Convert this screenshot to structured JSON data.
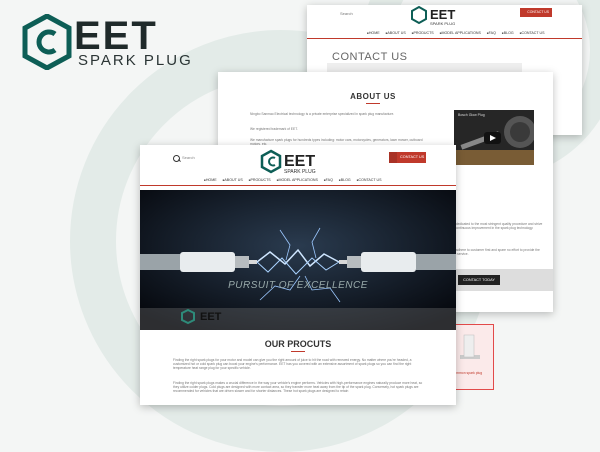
{
  "brand": {
    "name": "EET",
    "sub": "SPARK PLUG"
  },
  "colors": {
    "accent": "#c0392b",
    "brand_green": "#0d5e56"
  },
  "window_back": {
    "search_placeholder": "Search",
    "contact_label": "CONTACT US",
    "nav": [
      "HOME",
      "ABOUT US",
      "PRODUCTS",
      "MODEL APPLICATIONS",
      "FAQ",
      "BLOG",
      "CONTACT US"
    ],
    "page_title": "CONTACT US"
  },
  "window_mid": {
    "section_title": "ABOUT US",
    "paragraphs": [
      "Ningbo Sanmao Electrical technology is a private enterprise specialized in spark plug manufacture.",
      "We registered trademark of EET.",
      "We manufacture spark plugs for hundreds types including: motor cars, motorcycles, generators, lawn mower, outboard motors, etc.",
      "We dedicated to the most stringent quality procedure and strive for continuous improvement in the spark plug technology.",
      "We adhere to customer first and spare no effort to provide the best service."
    ],
    "video_title": "Bosch Glow Plug",
    "contact_today": "CONTACT TODAY",
    "product_caption": "Common spark plug"
  },
  "window_front": {
    "search_placeholder": "Search",
    "contact_label": "CONTACT US",
    "nav": [
      "HOME",
      "ABOUT US",
      "PRODUCTS",
      "MODEL APPLICATIONS",
      "FAQ",
      "BLOG",
      "CONTACT US"
    ],
    "hero_tagline": "PURSUIT OF EXCELLENCE",
    "hero_logo": "EET",
    "section_title": "OUR PROCUTS",
    "paragraphs": [
      "Finding the right spark plugs for your motor and model can give you the right amount of juice to hit the road with renewed energy. No matter where you're headed, a customized hot or cold spark plug can boost your engine's performance. EET has you covered with an extensive assortment of spark plugs so you can find the right temperature heat range plug for your specific vehicle.",
      "Finding the right spark plugs makes a crucial difference in the way your vehicle's engine performs. Vehicles with high-performance engines naturally produce more heat, so they utilize colder plugs. Cold plugs are designed with more contact area, so they transfer more heat away from the tip of the spark plug. Conversely, hot spark plugs are recommended for vehicles that are driven slower and for shorter distances. These hot spark plugs are designed to retain"
    ]
  }
}
